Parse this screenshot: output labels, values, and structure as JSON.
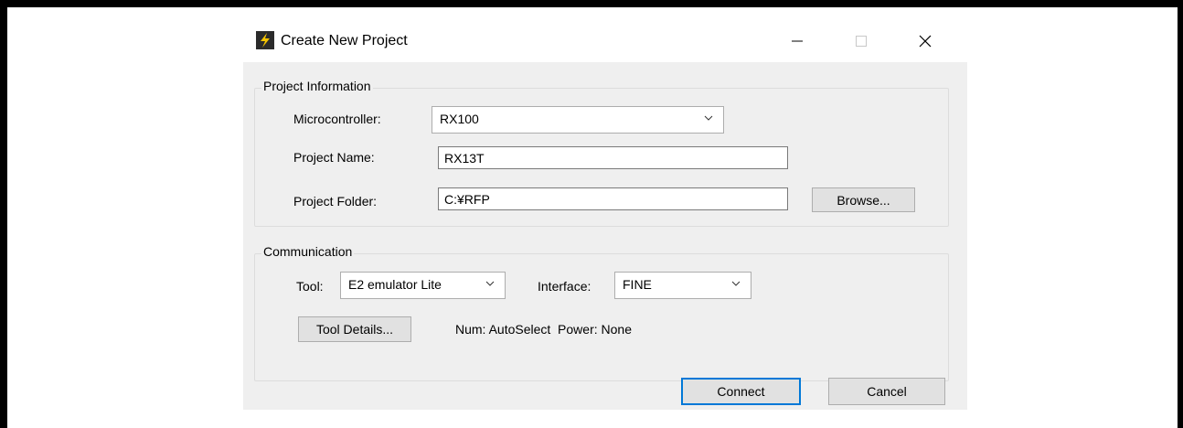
{
  "window": {
    "title": "Create New Project",
    "icon": "app-lightning-icon",
    "controls": [
      "minimize-icon",
      "maximize-icon",
      "close-icon"
    ]
  },
  "project_info": {
    "group_label": "Project Information",
    "microcontroller": {
      "label": "Microcontroller:",
      "value": "RX100"
    },
    "project_name": {
      "label": "Project Name:",
      "value": "RX13T"
    },
    "project_folder": {
      "label": "Project Folder:",
      "value": "C:¥RFP",
      "browse_label": "Browse..."
    }
  },
  "communication": {
    "group_label": "Communication",
    "tool": {
      "label": "Tool:",
      "value": "E2 emulator Lite"
    },
    "interface": {
      "label": "Interface:",
      "value": "FINE"
    },
    "tool_details_label": "Tool Details...",
    "status_text": "Num: AutoSelect  Power: None"
  },
  "footer": {
    "connect_label": "Connect",
    "cancel_label": "Cancel"
  }
}
